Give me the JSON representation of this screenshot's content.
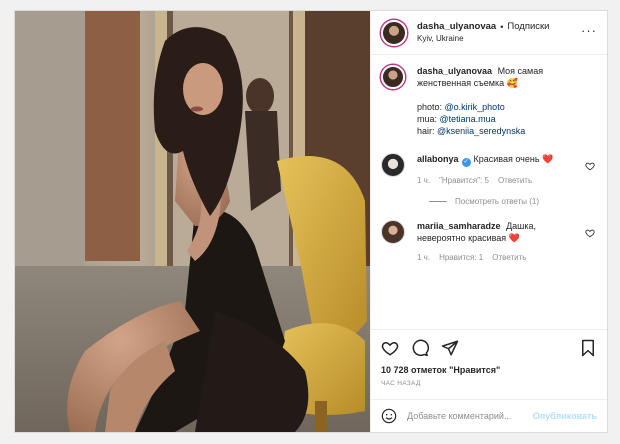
{
  "header": {
    "username": "dasha_ulyanovaa",
    "separator": "•",
    "follow_label": "Подписки",
    "location": "Kyiv, Ukraine",
    "more_icon": "more-horizontal-icon"
  },
  "caption": {
    "username": "dasha_ulyanovaa",
    "text_1": "Моя самая",
    "text_2": "женственная съемка 🥰",
    "photo_prefix": "photo: ",
    "photo_mention": "@o.kirik_photo",
    "mua_prefix": "mua: ",
    "mua_mention": "@tetiana.mua",
    "hair_prefix": "hair: ",
    "hair_mention": "@kseniia_seredynska"
  },
  "comments": [
    {
      "username": "allabonya",
      "verified": true,
      "text": "Красивая очень ❤️",
      "time": "1 ч.",
      "likes": "\"Нравится\": 5",
      "reply": "Ответить",
      "view_replies": "Посмотреть ответы (1)"
    },
    {
      "username": "mariia_samharadze",
      "text_1": "Дашка,",
      "text_2": "невероятно красивая ❤️",
      "time": "1 ч.",
      "likes": "Нравится: 1",
      "reply": "Ответить"
    }
  ],
  "actions": {
    "like_icon": "heart-outline-icon",
    "comment_icon": "comment-icon",
    "share_icon": "paper-plane-icon",
    "save_icon": "bookmark-icon"
  },
  "likes": {
    "count": "10 728",
    "label": "отметок \"Нравится\""
  },
  "time_ago": "ЧАС НАЗАД",
  "add_comment": {
    "placeholder": "Добавьте комментарий...",
    "publish_label": "Опубликовать",
    "emoji_icon": "smiley-icon"
  },
  "colors": {
    "link": "#00376b",
    "publish_disabled": "#b2dffc",
    "muted": "#8e8e8e",
    "heart": "#ed4956",
    "verified": "#3897f0"
  }
}
